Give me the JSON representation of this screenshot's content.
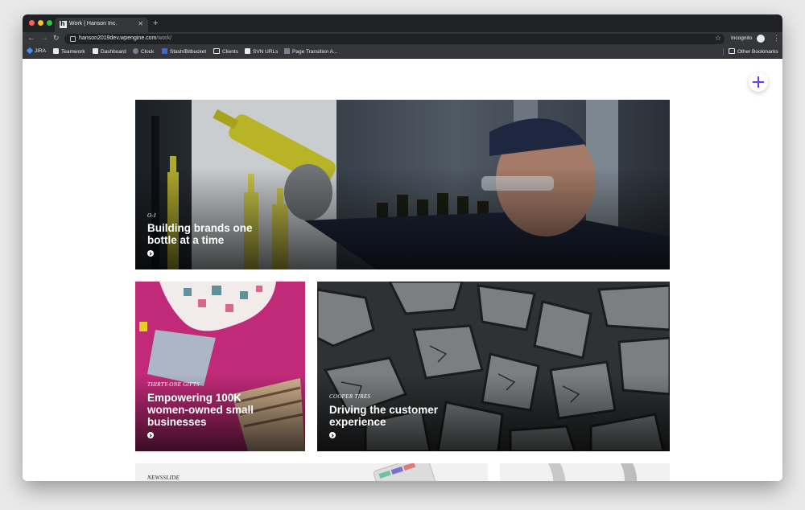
{
  "browser": {
    "tab": {
      "title": "Work | Hanson Inc."
    },
    "address_bar": {
      "domain": "hanson2019dev.wpengine.com",
      "path": "/work/"
    },
    "profile": {
      "label": "Incognito"
    },
    "bookmarks": [
      {
        "label": "JIRA",
        "icon": "jira-icon"
      },
      {
        "label": "Teamwork",
        "icon": "hanson-favicon"
      },
      {
        "label": "Dashboard",
        "icon": "hanson-favicon"
      },
      {
        "label": "Clock",
        "icon": "clock-icon"
      },
      {
        "label": "Stash/Bitbucket",
        "icon": "bitbucket-icon"
      },
      {
        "label": "Clients",
        "icon": "folder-icon"
      },
      {
        "label": "SVN URLs",
        "icon": "hanson-favicon"
      },
      {
        "label": "Page Transition A...",
        "icon": "gear-icon"
      }
    ],
    "other_bookmarks": "Other Bookmarks"
  },
  "page": {
    "accent": "#6a3cf0",
    "cards": [
      {
        "category": "O-I",
        "title_lines": [
          "Building brands one",
          "bottle at a time"
        ]
      },
      {
        "category": "THIRTY-ONE GIFTS",
        "title_lines": [
          "Empowering 100K",
          "women-owned small",
          "businesses"
        ]
      },
      {
        "category": "COOPER TIRES",
        "title_lines": [
          "Driving the customer",
          "experience"
        ]
      },
      {
        "category": "NEWSSLIDE"
      }
    ]
  }
}
